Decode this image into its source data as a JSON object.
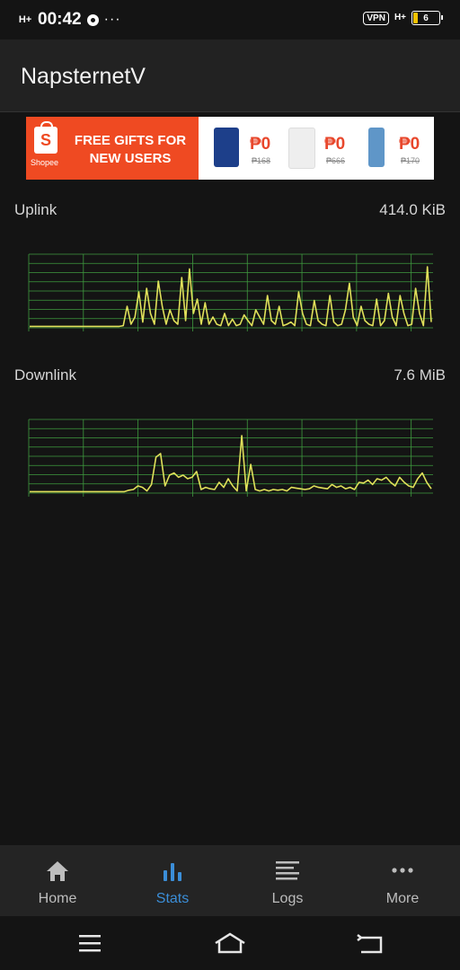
{
  "status_bar": {
    "network_left": "H+",
    "time": "00:42",
    "more": "···",
    "vpn": "VPN",
    "network_right": "H+",
    "battery": "6"
  },
  "app": {
    "title": "NapsternetV"
  },
  "ad": {
    "brand": "Shopee",
    "headline_line1": "FREE GIFTS FOR",
    "headline_line2": "NEW USERS",
    "items": [
      {
        "price": "₱0",
        "old_price": "₱168"
      },
      {
        "price": "₱0",
        "old_price": "₱666"
      },
      {
        "price": "₱0",
        "old_price": "₱170"
      }
    ]
  },
  "stats": {
    "uplink": {
      "label": "Uplink",
      "value": "414.0 KiB"
    },
    "downlink": {
      "label": "Downlink",
      "value": "7.6 MiB"
    }
  },
  "chart_data": [
    {
      "type": "line",
      "title": "",
      "ylim": [
        0,
        100
      ],
      "grid": true,
      "series": [
        {
          "values": [
            2,
            2,
            2,
            2,
            2,
            2,
            2,
            2,
            2,
            2,
            2,
            2,
            2,
            2,
            2,
            2,
            2,
            2,
            2,
            2,
            2,
            2,
            2,
            2,
            3,
            30,
            5,
            15,
            50,
            8,
            55,
            20,
            5,
            65,
            30,
            5,
            25,
            10,
            5,
            70,
            10,
            82,
            20,
            40,
            5,
            35,
            5,
            15,
            5,
            3,
            20,
            3,
            12,
            3,
            5,
            18,
            10,
            3,
            25,
            15,
            5,
            45,
            10,
            5,
            30,
            3,
            5,
            8,
            3,
            50,
            20,
            5,
            3,
            38,
            10,
            5,
            3,
            45,
            8,
            3,
            5,
            25,
            62,
            15,
            3,
            30,
            10,
            5,
            3,
            40,
            3,
            10,
            48,
            15,
            3,
            45,
            20,
            3,
            5,
            55,
            20,
            3,
            85,
            8
          ]
        }
      ]
    },
    {
      "type": "line",
      "title": "",
      "ylim": [
        0,
        100
      ],
      "grid": true,
      "series": [
        {
          "values": [
            2,
            2,
            2,
            2,
            2,
            2,
            2,
            2,
            2,
            2,
            2,
            2,
            2,
            2,
            2,
            2,
            2,
            2,
            2,
            2,
            2,
            2,
            4,
            5,
            10,
            8,
            3,
            12,
            50,
            55,
            10,
            25,
            28,
            22,
            25,
            20,
            22,
            30,
            5,
            8,
            6,
            5,
            15,
            8,
            20,
            10,
            3,
            80,
            3,
            40,
            5,
            3,
            5,
            3,
            5,
            4,
            5,
            3,
            8,
            7,
            6,
            5,
            6,
            10,
            8,
            7,
            6,
            12,
            8,
            10,
            6,
            8,
            5,
            15,
            14,
            18,
            12,
            20,
            18,
            22,
            15,
            10,
            22,
            15,
            10,
            8,
            20,
            28,
            15,
            6
          ]
        }
      ]
    }
  ],
  "nav": {
    "items": [
      {
        "label": "Home",
        "icon": "home-icon"
      },
      {
        "label": "Stats",
        "icon": "bar-chart-icon"
      },
      {
        "label": "Logs",
        "icon": "list-lines-icon"
      },
      {
        "label": "More",
        "icon": "more-dots-icon"
      }
    ],
    "active": "Stats",
    "active_color": "#3b8ed8",
    "inactive_color": "#bdbdbd"
  },
  "colors": {
    "graph_grid": "#3f9a3f",
    "graph_line": "#e0e05a",
    "app_bar": "#222222",
    "background": "#141414"
  }
}
